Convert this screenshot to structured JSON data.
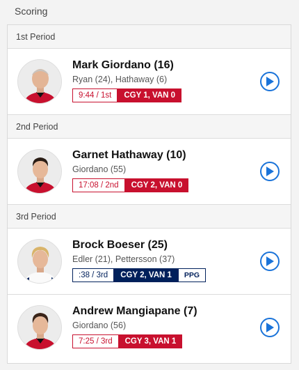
{
  "section_title": "Scoring",
  "periods": [
    {
      "label": "1st Period",
      "goals": [
        {
          "player": "Mark Giordano (16)",
          "assists": "Ryan (24), Hathaway (6)",
          "time": "9:44 / 1st",
          "score": "CGY 1, VAN 0",
          "team_color": "#c8102e",
          "strength": ""
        }
      ]
    },
    {
      "label": "2nd Period",
      "goals": [
        {
          "player": "Garnet Hathaway (10)",
          "assists": "Giordano (55)",
          "time": "17:08 / 2nd",
          "score": "CGY 2, VAN 0",
          "team_color": "#c8102e",
          "strength": ""
        }
      ]
    },
    {
      "label": "3rd Period",
      "goals": [
        {
          "player": "Brock Boeser (25)",
          "assists": "Edler (21), Pettersson (37)",
          "time": ":38 / 3rd",
          "score": "CGY 2, VAN 1",
          "team_color": "#00205b",
          "strength": "PPG"
        },
        {
          "player": "Andrew Mangiapane (7)",
          "assists": "Giordano (56)",
          "time": "7:25 / 3rd",
          "score": "CGY 3, VAN 1",
          "team_color": "#c8102e",
          "strength": ""
        }
      ]
    }
  ],
  "icons": {
    "play": "play-icon",
    "avatar": "player-headshot"
  },
  "colors": {
    "calgary_red": "#c8102e",
    "vancouver_blue": "#00205b",
    "play_blue": "#1a73d9"
  }
}
